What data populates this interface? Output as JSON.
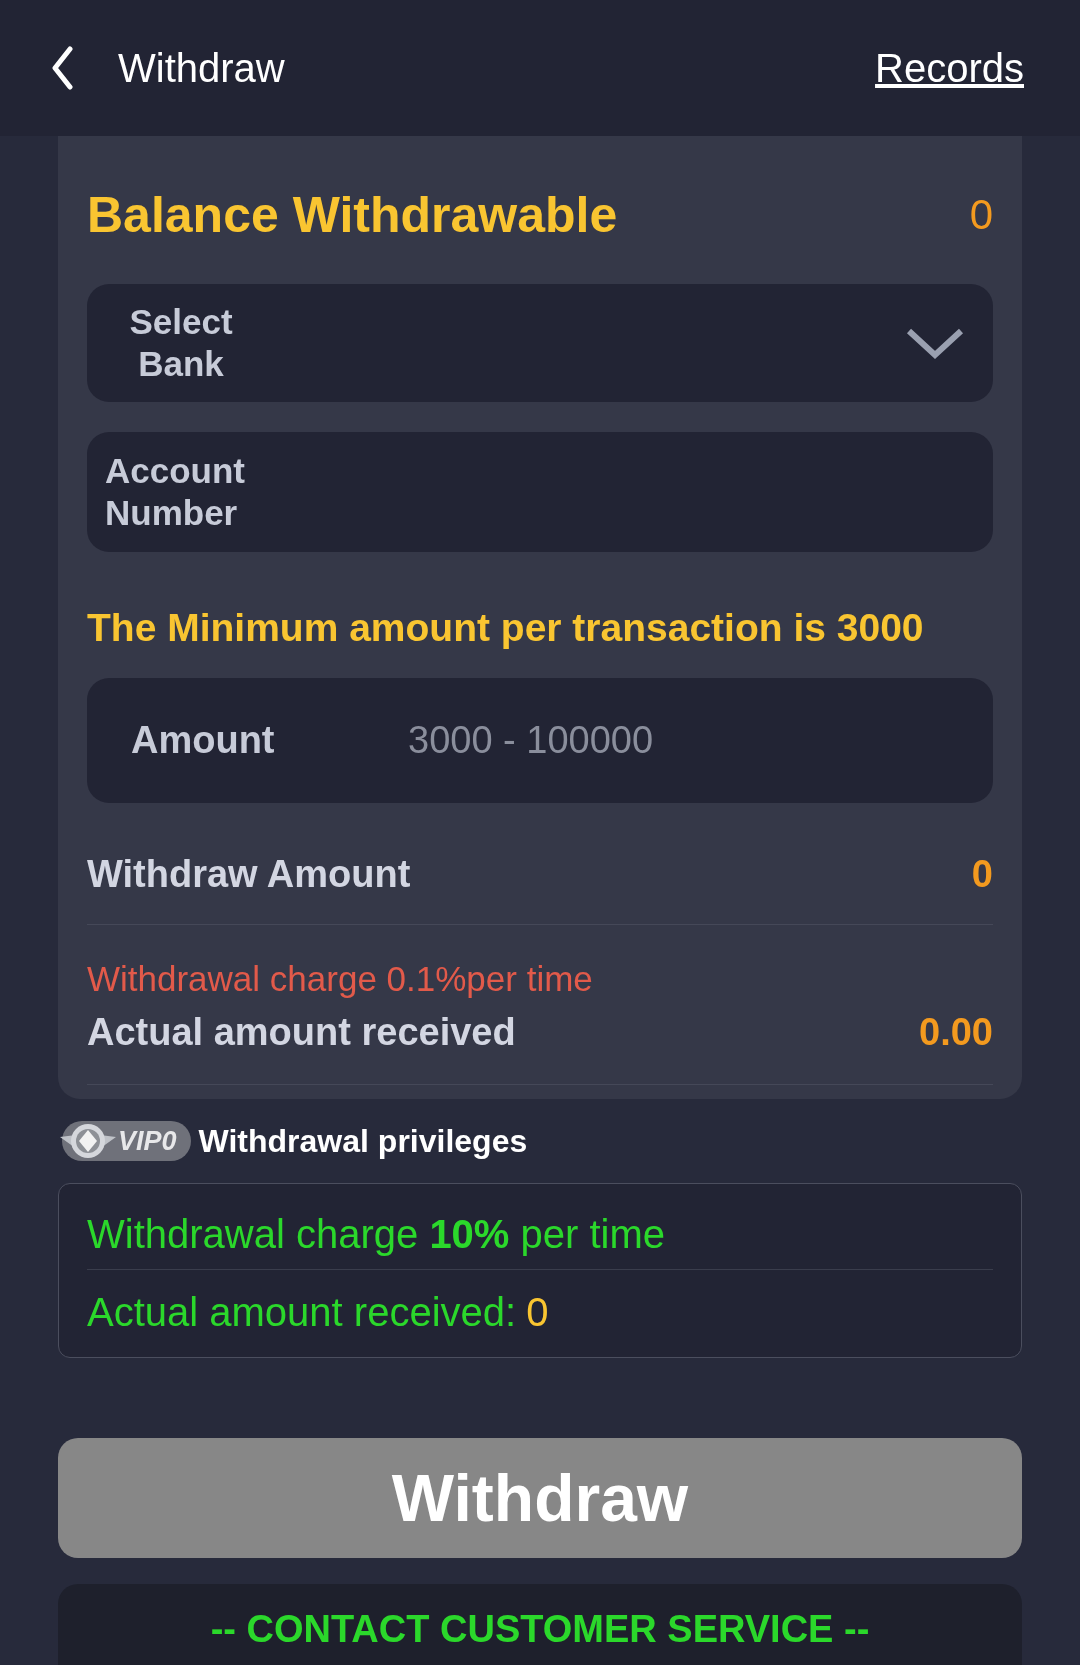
{
  "header": {
    "title": "Withdraw",
    "records_link": "Records"
  },
  "balance": {
    "label": "Balance Withdrawable",
    "value": "0"
  },
  "bank_select": {
    "placeholder": "Select Bank"
  },
  "account_field": {
    "placeholder": "Account Number"
  },
  "minimum_note": "The Minimum amount per transaction is 3000",
  "amount_field": {
    "label": "Amount",
    "placeholder": "3000 - 100000"
  },
  "withdraw_amount": {
    "label": "Withdraw Amount",
    "value": "0"
  },
  "charge_note": "Withdrawal charge 0.1%per time",
  "actual_received": {
    "label": "Actual amount received",
    "value": "0.00"
  },
  "vip": {
    "badge": "VIP0",
    "title": "Withdrawal privileges",
    "charge": "Withdrawal charge **10%** per time",
    "received_label": "Actual amount received:",
    "received_value": "0"
  },
  "submit": {
    "label": "Withdraw",
    "disabled": true
  },
  "contact": "-- CONTACT CUSTOMER SERVICE --"
}
